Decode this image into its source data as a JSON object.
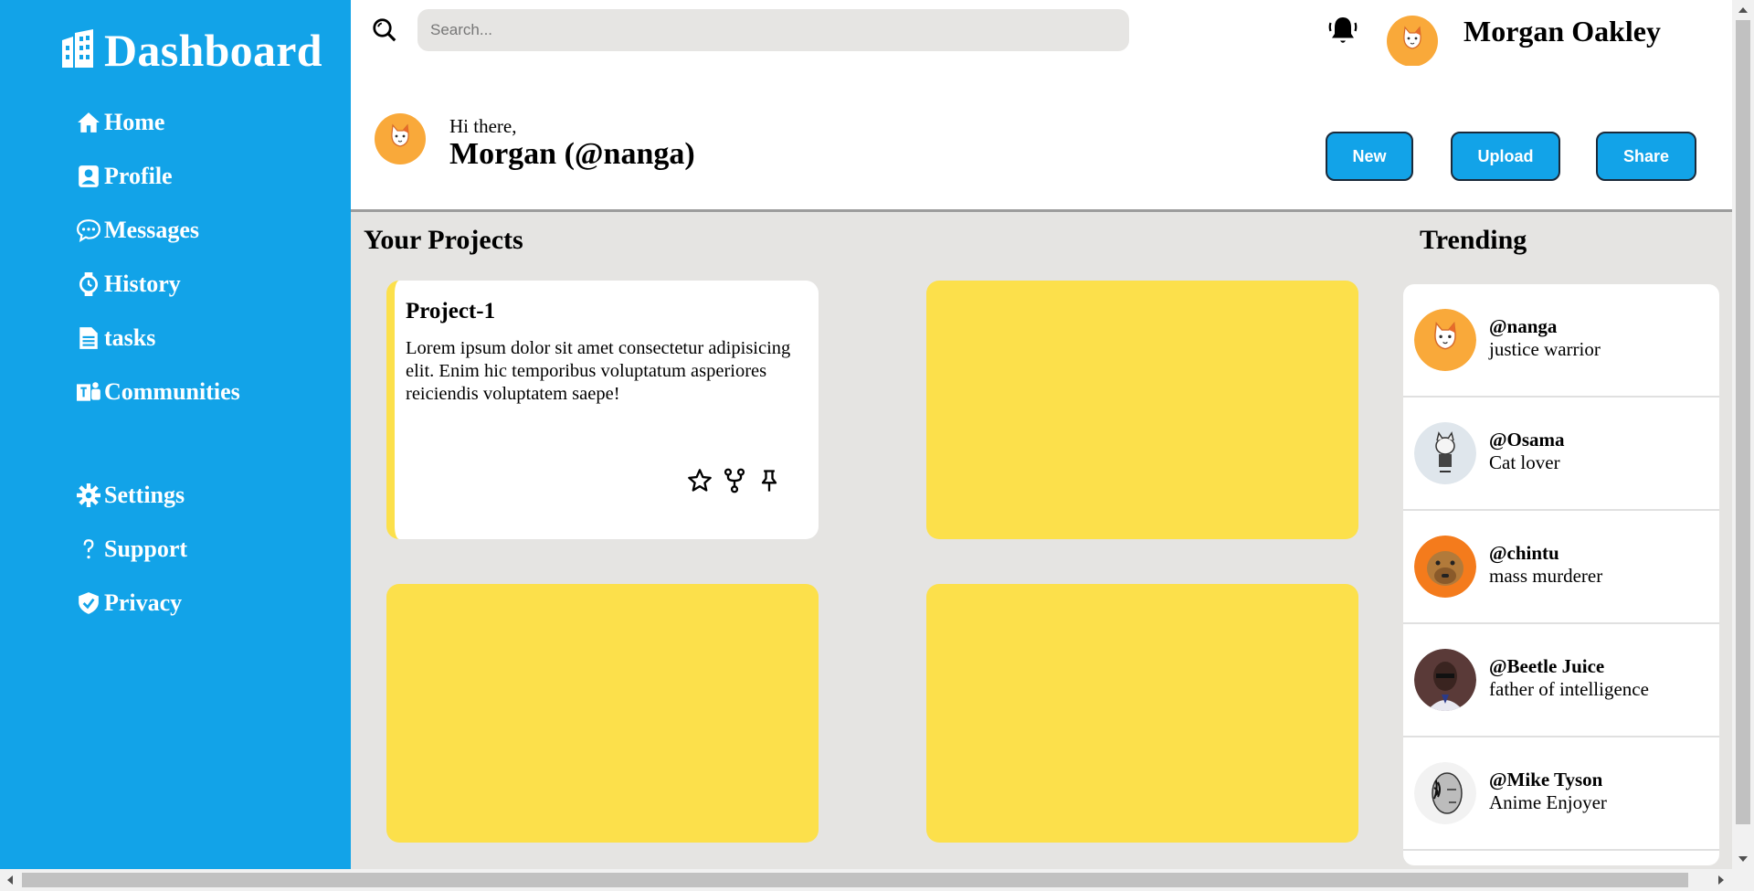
{
  "sidebar": {
    "brand": "Dashboard",
    "items": [
      {
        "label": "Home",
        "icon": "home-icon"
      },
      {
        "label": "Profile",
        "icon": "profile-icon"
      },
      {
        "label": "Messages",
        "icon": "chat-icon"
      },
      {
        "label": "History",
        "icon": "watch-icon"
      },
      {
        "label": "tasks",
        "icon": "document-icon"
      },
      {
        "label": "Communities",
        "icon": "teams-icon"
      }
    ],
    "bottom_items": [
      {
        "label": "Settings",
        "icon": "gear-icon"
      },
      {
        "label": "Support",
        "icon": "question-icon"
      },
      {
        "label": "Privacy",
        "icon": "shield-icon"
      }
    ]
  },
  "topbar": {
    "search_placeholder": "Search...",
    "user_name": "Morgan Oakley"
  },
  "header": {
    "greeting": "Hi there,",
    "name": "Morgan (@nanga)",
    "buttons": {
      "new": "New",
      "upload": "Upload",
      "share": "Share"
    }
  },
  "projects": {
    "title": "Your Projects",
    "cards": [
      {
        "title": "Project-1",
        "body": "Lorem ipsum dolor sit amet consectetur adipisicing elit. Enim hic temporibus voluptatum asperiores reiciendis voluptatem saepe!"
      }
    ]
  },
  "trending": {
    "title": "Trending",
    "items": [
      {
        "handle": "@nanga",
        "desc": "justice warrior"
      },
      {
        "handle": "@Osama",
        "desc": "Cat lover"
      },
      {
        "handle": "@chintu",
        "desc": "mass murderer"
      },
      {
        "handle": "@Beetle Juice",
        "desc": "father of intelligence"
      },
      {
        "handle": "@Mike Tyson",
        "desc": "Anime Enjoyer"
      }
    ]
  },
  "colors": {
    "sidebar": "#12a3e8",
    "accent_yellow": "#fce04b",
    "avatar_orange": "#f9a93a",
    "background": "#e5e4e2"
  }
}
